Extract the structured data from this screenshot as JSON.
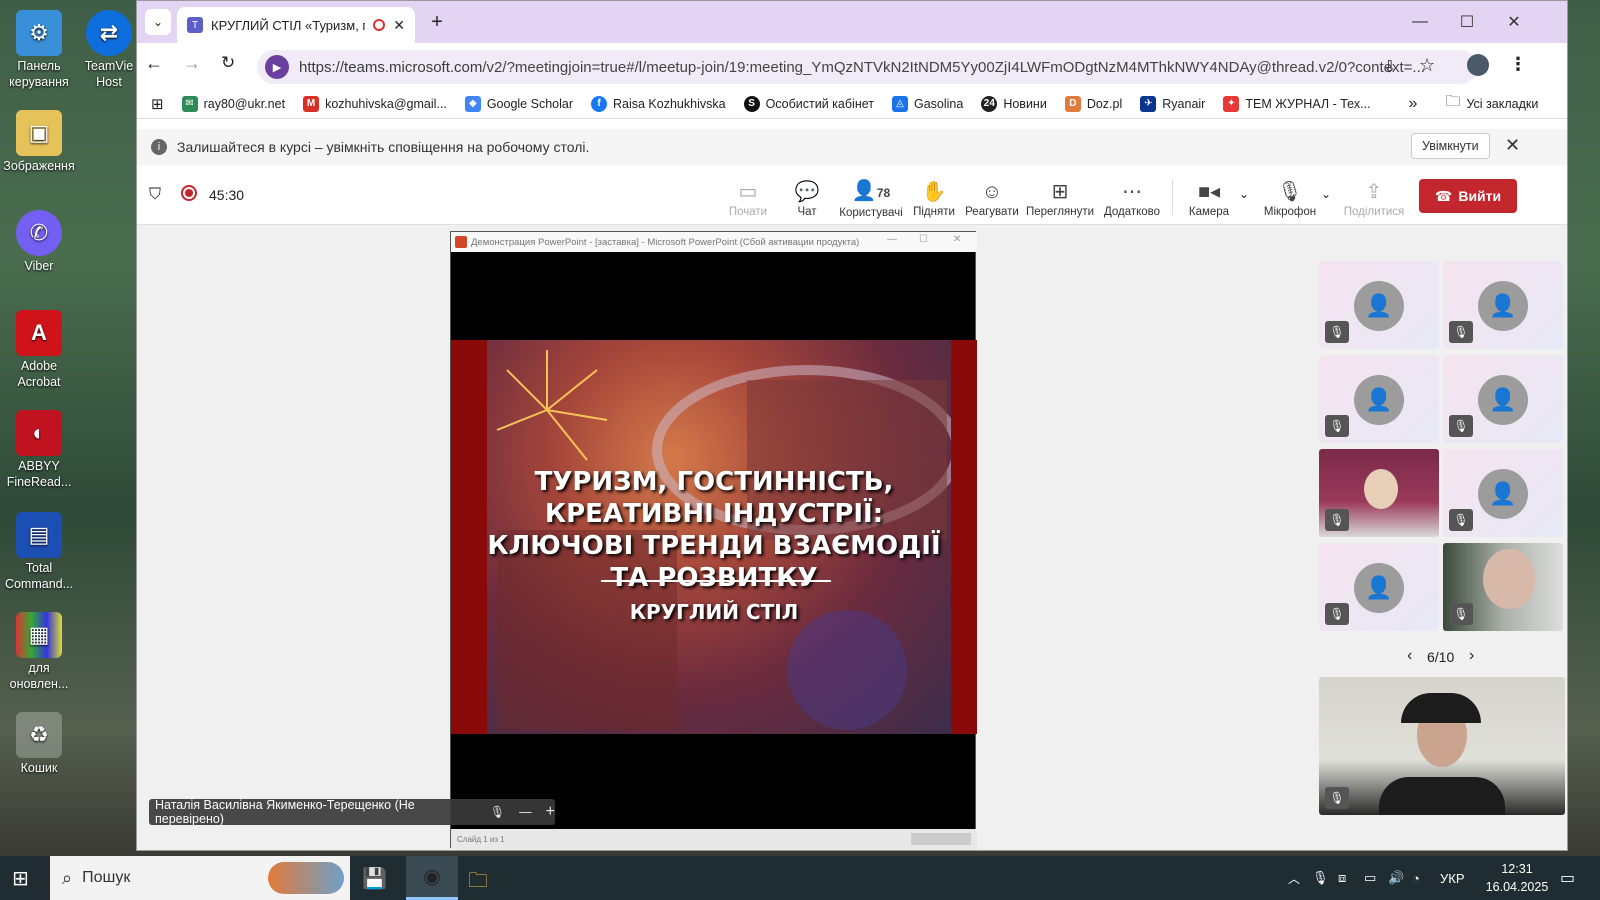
{
  "desktop": {
    "icons": [
      {
        "label": "Панель керування",
        "icon": "control-panel-icon"
      },
      {
        "label": "TeamViewer Host",
        "icon": "teamviewer-icon"
      },
      {
        "label": "Зображення",
        "icon": "pictures-folder-icon"
      },
      {
        "label": "Viber",
        "icon": "viber-icon"
      },
      {
        "label": "Adobe Acrobat",
        "icon": "acrobat-icon"
      },
      {
        "label": "ABBYY FineRead...",
        "icon": "abbyy-icon"
      },
      {
        "label": "Total Command...",
        "icon": "total-commander-icon"
      },
      {
        "label": "для оновлен...",
        "icon": "archive-icon"
      },
      {
        "label": "Кошик",
        "icon": "recycle-bin-icon"
      }
    ],
    "teamviewer_label": "TeamVie Host"
  },
  "browser": {
    "tab_title": "КРУГЛИЙ СТІЛ «Туризм, го",
    "url_host": "https://teams.microsoft.com",
    "url_path": "/v2/?meetingjoin=true#/l/meetup-join/19:meeting_YmQzNTVkN2ItNDM5Yy00ZjI4LWFmODgtNzM4MThkNWY4NDAy@thread.v2/0?context=...",
    "bookmarks": [
      {
        "label": "ray80@ukr.net",
        "color": "#2e8b57"
      },
      {
        "label": "kozhuhivska@gmail...",
        "color": "#d93025"
      },
      {
        "label": "Google Scholar",
        "color": "#4285f4"
      },
      {
        "label": "Raisa Kozhukhivska",
        "color": "#1877f2"
      },
      {
        "label": "Особистий кабінет",
        "color": "#111111"
      },
      {
        "label": "Gasolina",
        "color": "#1a73e8"
      },
      {
        "label": "Новини",
        "color": "#222222"
      },
      {
        "label": "Doz.pl",
        "color": "#e07b39"
      },
      {
        "label": "Ryanair",
        "color": "#073590"
      },
      {
        "label": "ТЕМ ЖУРНАЛ - Тех...",
        "color": "#e53935"
      }
    ],
    "all_bookmarks": "Усі закладки",
    "more": "»"
  },
  "notification": {
    "text": "Залишайтеся в курсі – увімкніть сповіщення на робочому столі.",
    "button": "Увімкнути"
  },
  "meeting": {
    "timer": "45:30",
    "participants_count": "78",
    "controls": {
      "start": "Почати",
      "chat": "Чат",
      "people": "Користувачі",
      "raise": "Підняти",
      "react": "Реагувати",
      "view": "Переглянути",
      "more": "Додатково",
      "camera": "Камера",
      "mic": "Мікрофон",
      "share": "Поділитися",
      "leave": "Вийти"
    },
    "pagination": "6/10",
    "presenter_name": "Наталія Василівна Якименко-Терещенко (Не перевірено)"
  },
  "ppt": {
    "window_title": "Демонстрация PowerPoint - [заставка] - Microsoft PowerPoint (Сбой активации продукта)",
    "status": "Слайд 1 из 1",
    "slide_title_lines": [
      "ТУРИЗМ, ГОСТИННІСТЬ,",
      "КРЕАТИВНІ ІНДУСТРІЇ:",
      "КЛЮЧОВІ ТРЕНДИ ВЗАЄМОДІЇ",
      "ТА РОЗВИТКУ"
    ],
    "slide_subtitle": "КРУГЛИЙ СТІЛ"
  },
  "taskbar": {
    "search_label": "Пошук",
    "language": "УКР",
    "time": "12:31",
    "date": "16.04.2025"
  },
  "colors": {
    "leave_button": "#c4262e",
    "tab_strip": "#e4d4f4",
    "taskbar": "#1f2d33"
  }
}
